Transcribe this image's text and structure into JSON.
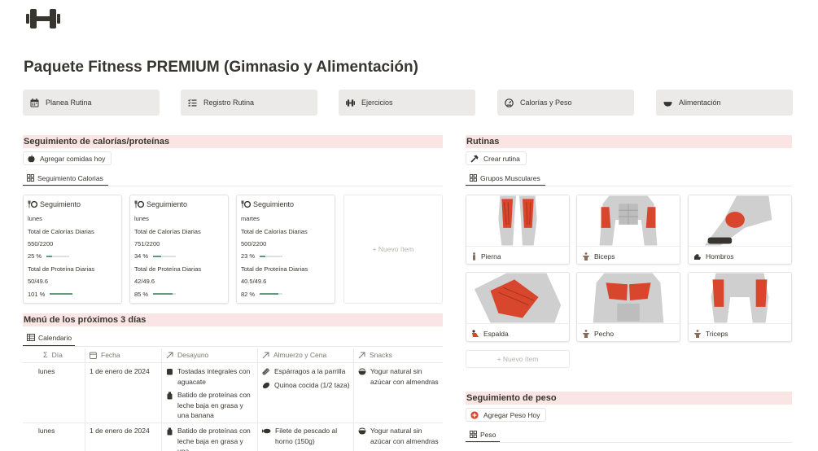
{
  "page": {
    "title": "Paquete Fitness PREMIUM (Gimnasio y Alimentación)"
  },
  "nav": [
    {
      "label": "Planea Rutina",
      "icon": "calendar-icon"
    },
    {
      "label": "Registro Rutina",
      "icon": "checklist-icon"
    },
    {
      "label": "Ejercicios",
      "icon": "dumbbell-icon"
    },
    {
      "label": "Calorías y Peso",
      "icon": "gauge-icon"
    },
    {
      "label": "Alimentación",
      "icon": "bowl-icon"
    }
  ],
  "calorias": {
    "header": "Seguimiento de calorías/proteínas",
    "add_button": "Agregar comidas hoy",
    "view_tab": "Seguimiento Calorias",
    "cards": [
      {
        "title": "Seguimiento",
        "day": "lunes",
        "cal_label": "Total de Calorías Diarias",
        "cal_value": "550/2200",
        "cal_pct": "25 %",
        "cal_frac": 0.25,
        "prot_label": "Total de Proteína Diarias",
        "prot_value": "50/49.6",
        "prot_pct": "101 %",
        "prot_frac": 1.0
      },
      {
        "title": "Seguimiento",
        "day": "lunes",
        "cal_label": "Total de Calorías Diarias",
        "cal_value": "751/2200",
        "cal_pct": "34 %",
        "cal_frac": 0.34,
        "prot_label": "Total de Proteína Diarias",
        "prot_value": "42/49.6",
        "prot_pct": "85 %",
        "prot_frac": 0.85
      },
      {
        "title": "Seguimiento",
        "day": "martes",
        "cal_label": "Total de Calorías Diarias",
        "cal_value": "500/2200",
        "cal_pct": "23 %",
        "cal_frac": 0.23,
        "prot_label": "Total de Proteína Diarias",
        "prot_value": "40.5/49.6",
        "prot_pct": "82 %",
        "prot_frac": 0.82
      }
    ],
    "new_item": "+ Nuevo ítem"
  },
  "menu": {
    "header": "Menú de los próximos 3 días",
    "view_tab": "Calendario",
    "columns": [
      "Día",
      "Fecha",
      "Desayuno",
      "Almuerzo y Cena",
      "Snacks"
    ],
    "rows": [
      {
        "dia": "lunes",
        "fecha": "1 de enero de 2024",
        "desayuno": [
          "Tostadas integrales con aguacate",
          "Batido de proteínas con leche baja en grasa y una banana"
        ],
        "almuerzo": [
          "Espárragos a la parrilla",
          "Quinoa cocida (1/2 taza)"
        ],
        "snacks": [
          "Yogur natural sin azúcar con almendras"
        ]
      },
      {
        "dia": "lunes",
        "fecha": "1 de enero de 2024",
        "desayuno": [
          "Batido de proteínas con leche baja en grasa y una"
        ],
        "almuerzo": [
          "Filete de pescado al horno (150g)"
        ],
        "snacks": [
          "Yogur natural sin azúcar con almendras"
        ]
      }
    ]
  },
  "rutinas": {
    "header": "Rutinas",
    "create_button": "Crear rutina",
    "view_tab": "Grupos Musculares",
    "groups": [
      "Pierna",
      "Biceps",
      "Hombros",
      "Espalda",
      "Pecho",
      "Triceps"
    ],
    "new_item": "+ Nuevo ítem"
  },
  "peso": {
    "header": "Seguimiento de peso",
    "add_button": "Agregar Peso Hoy",
    "view_tab": "Peso"
  },
  "colors": {
    "section_bg": "#fbe4e4",
    "nav_bg": "#ebeae8",
    "progress": "#5f9b7b",
    "muscle": "#d9462e"
  }
}
